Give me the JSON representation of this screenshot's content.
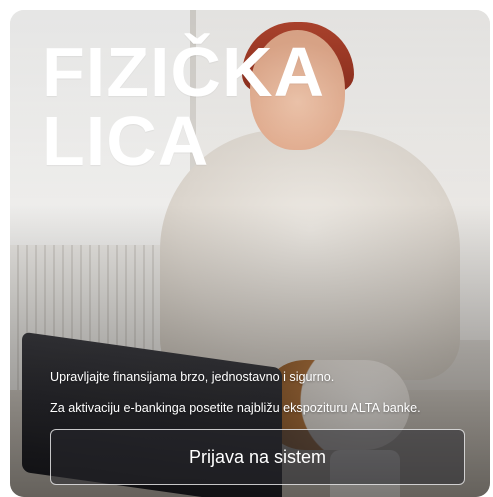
{
  "hero": {
    "title_line1": "FIZIČKA",
    "title_line2": "LICA",
    "text_line1": "Upravljajte finansijama brzo, jednostavno i sigurno.",
    "text_line2": "Za aktivaciju e-bankinga posetite najbližu ekspozituru ALTA banke.",
    "login_button": "Prijava na sistem"
  },
  "colors": {
    "title": "#ffffff",
    "text": "#ffffff",
    "button_border": "#ffffff"
  }
}
